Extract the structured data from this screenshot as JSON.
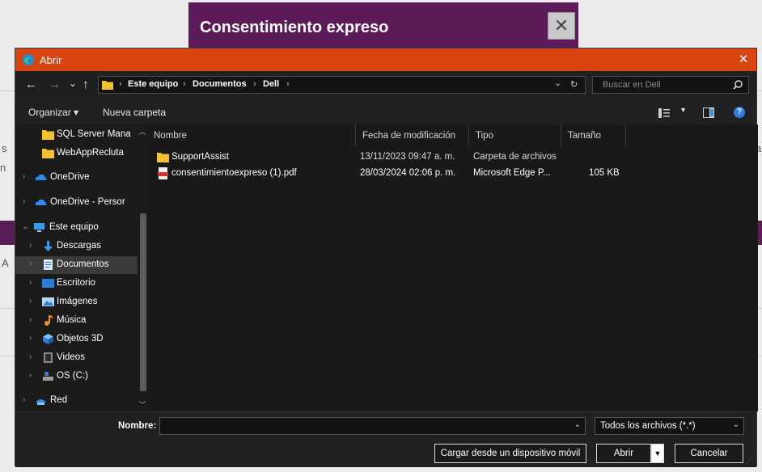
{
  "background": {
    "header_title": "Consentimiento expreso",
    "close_glyph": "✕"
  },
  "dialog": {
    "title": "Abrir",
    "close_glyph": "✕",
    "nav": {
      "back": "←",
      "forward": "→",
      "recent": "⌄",
      "up": "↑"
    },
    "breadcrumb": [
      "Este equipo",
      "Documentos",
      "Dell"
    ],
    "breadcrumb_sep": "›",
    "address_dropdown": "⌄",
    "refresh": "↻",
    "search_placeholder": "Buscar en Dell",
    "toolbar": {
      "organize": "Organizar ▾",
      "new_folder": "Nueva carpeta",
      "view_menu": "▾",
      "help": "?"
    },
    "nav_pane": [
      {
        "label": "SQL Server Mana",
        "icon": "folder-icon",
        "chevron": ""
      },
      {
        "label": "WebAppRecluta",
        "icon": "folder-icon",
        "chevron": ""
      },
      {
        "label": "OneDrive",
        "icon": "cloud-icon",
        "chevron": "›"
      },
      {
        "label": "OneDrive - Persor",
        "icon": "cloud-icon",
        "chevron": "›"
      },
      {
        "label": "Este equipo",
        "icon": "computer-icon",
        "chevron": "⌄"
      },
      {
        "label": "Descargas",
        "icon": "download-icon",
        "chevron": "›"
      },
      {
        "label": "Documentos",
        "icon": "document-icon",
        "chevron": "›",
        "selected": true
      },
      {
        "label": "Escritorio",
        "icon": "desktop-icon",
        "chevron": "›"
      },
      {
        "label": "Imágenes",
        "icon": "pictures-icon",
        "chevron": "›"
      },
      {
        "label": "Música",
        "icon": "music-icon",
        "chevron": "›"
      },
      {
        "label": "Objetos 3D",
        "icon": "3d-objects-icon",
        "chevron": "›"
      },
      {
        "label": "Videos",
        "icon": "video-icon",
        "chevron": "›"
      },
      {
        "label": "OS (C:)",
        "icon": "drive-icon",
        "chevron": "›"
      },
      {
        "label": "Red",
        "icon": "network-icon",
        "chevron": "›"
      }
    ],
    "columns": {
      "name": "Nombre",
      "modified": "Fecha de modificación",
      "type": "Tipo",
      "size": "Tamaño"
    },
    "files": [
      {
        "name": "SupportAssist",
        "modified": "13/11/2023 09:47 a. m.",
        "type": "Carpeta de archivos",
        "size": "",
        "icon": "folder-icon"
      },
      {
        "name": "consentimientoexpreso (1).pdf",
        "modified": "28/03/2024 02:06 p. m.",
        "type": "Microsoft Edge P...",
        "size": "105 KB",
        "icon": "pdf-icon"
      }
    ],
    "footer": {
      "filename_label": "Nombre:",
      "filename_value": "",
      "filter_value": "Todos los archivos (*.*)",
      "mobile_button": "Cargar desde un dispositivo móvil",
      "open_button": "Abrir",
      "cancel_button": "Cancelar"
    }
  },
  "colors": {
    "titlebar": "#d84512",
    "header_purple": "#5c1a59",
    "dialog_bg": "#202020"
  }
}
